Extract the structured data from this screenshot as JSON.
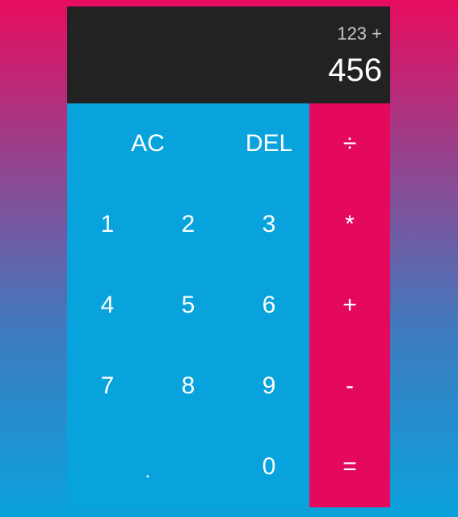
{
  "display": {
    "previous_operand": "123 +",
    "current_operand": "456"
  },
  "buttons": {
    "all_clear": "AC",
    "delete": "DEL",
    "divide": "÷",
    "one": "1",
    "two": "2",
    "three": "3",
    "multiply": "*",
    "four": "4",
    "five": "5",
    "six": "6",
    "add": "+",
    "seven": "7",
    "eight": "8",
    "nine": "9",
    "subtract": "-",
    "decimal": ".",
    "zero": "0",
    "equals": "="
  },
  "colors": {
    "display_background": "#222222",
    "number_key_background": "#08a2dc",
    "operator_key_background": "#e5095d",
    "page_gradient_top": "#e80c5e",
    "page_gradient_bottom": "#0aa2dc"
  }
}
